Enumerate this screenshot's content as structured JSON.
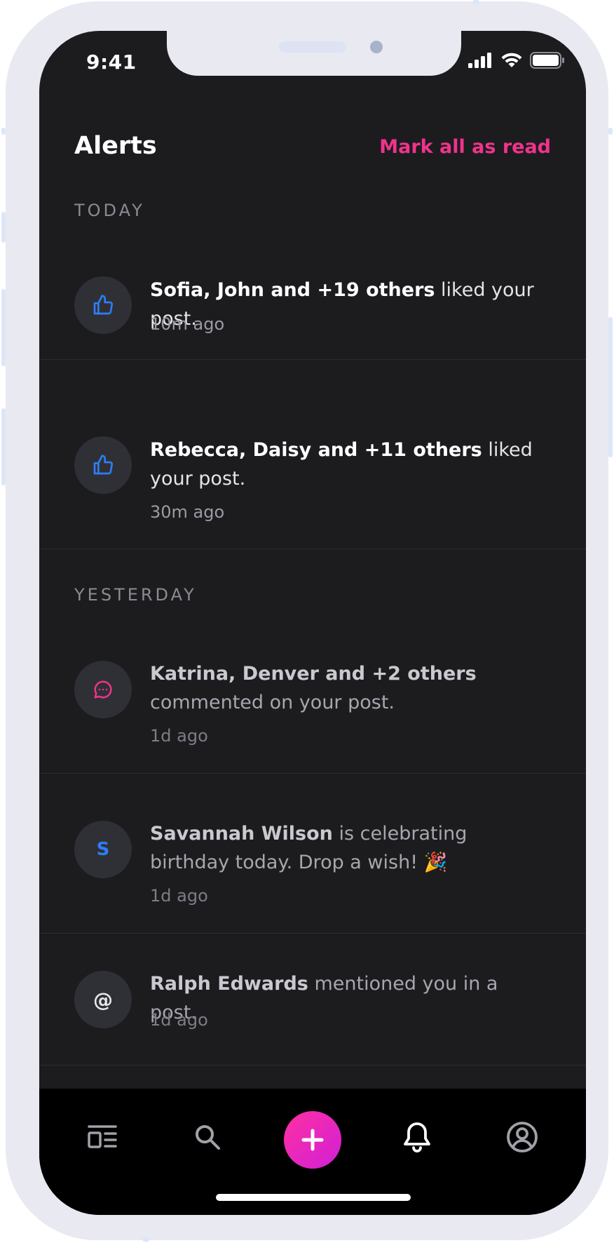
{
  "status_bar": {
    "time": "9:41"
  },
  "header": {
    "title": "Alerts",
    "mark_all_label": "Mark all as read"
  },
  "sections": [
    {
      "label": "TODAY",
      "items": [
        {
          "actor": "Sofia, John and +19 others",
          "action": " liked your post.",
          "time": "10m ago",
          "icon": "thumbs-up-icon",
          "icon_color": "#2e7df6"
        },
        {
          "actor": "Rebecca, Daisy and +11 others",
          "action": " liked your post.",
          "time": "30m ago",
          "icon": "thumbs-up-icon",
          "icon_color": "#2e7df6"
        }
      ]
    },
    {
      "label": "YESTERDAY",
      "items": [
        {
          "actor": "Katrina, Denver and +2 others",
          "action": " commented on your post.",
          "time": "1d ago",
          "icon": "comment-icon",
          "icon_color": "#f0338b"
        },
        {
          "actor": "Savannah Wilson",
          "action": " is celebrating birthday today. Drop a wish! 🎉",
          "time": "1d ago",
          "icon": "avatar-letter",
          "avatar_letter": "S",
          "icon_color": "#2e7df6"
        },
        {
          "actor": "Ralph Edwards",
          "action": " mentioned you in a post.",
          "time": "1d ago",
          "icon": "at-icon",
          "avatar_symbol": "@",
          "icon_color": "#e6e6ea"
        }
      ]
    }
  ],
  "tab_bar": {
    "tabs": [
      {
        "name": "feed",
        "icon": "feed-icon"
      },
      {
        "name": "search",
        "icon": "search-icon"
      },
      {
        "name": "create",
        "icon": "plus-icon"
      },
      {
        "name": "alerts",
        "icon": "bell-icon",
        "active": true
      },
      {
        "name": "profile",
        "icon": "profile-icon"
      }
    ]
  },
  "colors": {
    "accent": "#f0338b",
    "background": "#1c1c1f",
    "like_blue": "#2e7df6",
    "tab_bar": "#000000"
  }
}
